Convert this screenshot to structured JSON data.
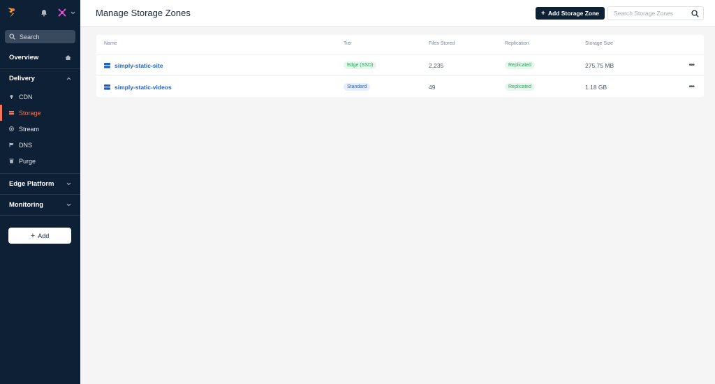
{
  "sidebar": {
    "search_label": "Search",
    "overview": "Overview",
    "delivery": "Delivery",
    "delivery_items": [
      "CDN",
      "Storage",
      "Stream",
      "DNS",
      "Purge"
    ],
    "edge_platform": "Edge Platform",
    "monitoring": "Monitoring",
    "add_label": "Add"
  },
  "header": {
    "title": "Manage Storage Zones",
    "add_zone_label": "Add Storage Zone",
    "search_placeholder": "Search Storage Zones"
  },
  "table": {
    "columns": [
      "Name",
      "Tier",
      "Files Stored",
      "Replication",
      "Storage Size"
    ],
    "rows": [
      {
        "name": "simply-static-site",
        "tier": "Edge (SSD)",
        "files": "2,235",
        "replication": "Replicated",
        "size": "275.75 MB"
      },
      {
        "name": "simply-static-videos",
        "tier": "Standard",
        "files": "49",
        "replication": "Replicated",
        "size": "1.18 GB"
      }
    ]
  },
  "colors": {
    "sidebar_bg": "#0e2035",
    "accent": "#f2765b",
    "link": "#1f62c5",
    "replicated": "#2aa25a"
  },
  "icons": [
    "bunny-logo-icon",
    "bell-icon",
    "avatar-icon",
    "chevron-down-icon",
    "search-icon",
    "home-icon",
    "chevron-up-icon",
    "cdn-icon",
    "storage-icon",
    "stream-icon",
    "dns-icon",
    "purge-icon",
    "plus-icon",
    "storage-zone-icon",
    "more-icon"
  ]
}
